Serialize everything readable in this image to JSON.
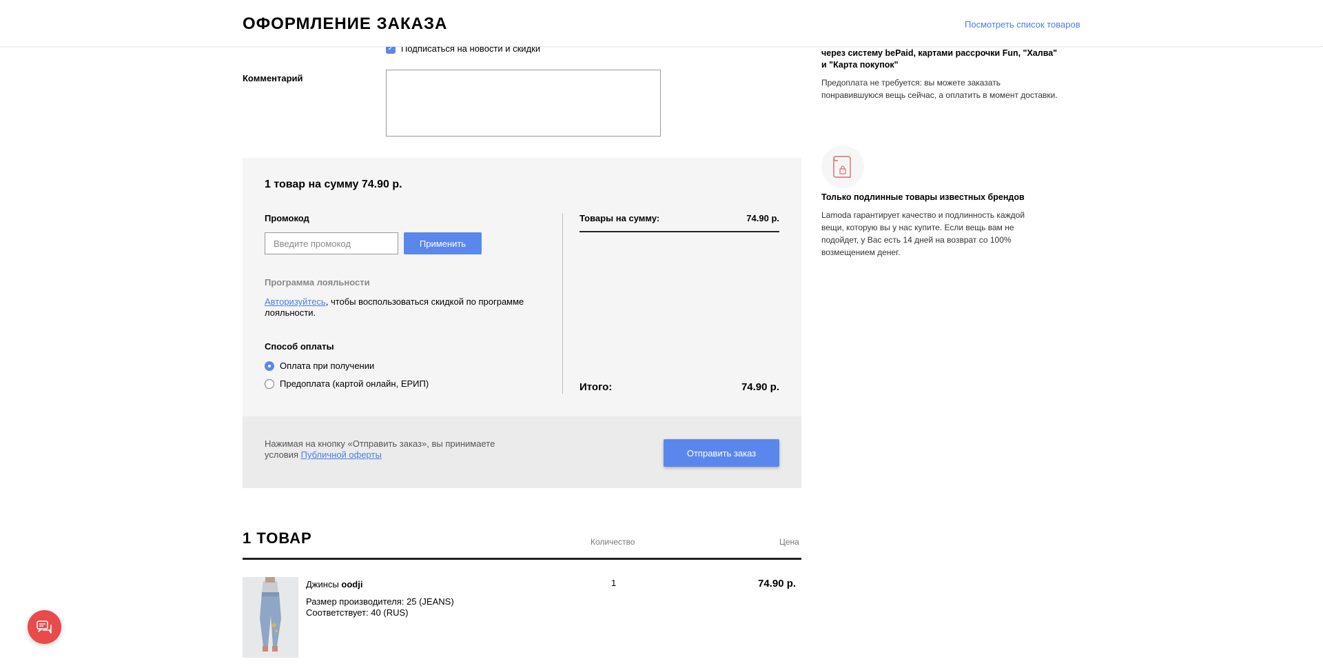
{
  "header": {
    "title": "ОФОРМЛЕНИЕ ЗАКАЗА",
    "view_list_link": "Посмотреть список товаров"
  },
  "form": {
    "subscribe_label": "Подписаться на новости и скидки",
    "subscribe_checked": true,
    "comment_label": "Комментарий",
    "comment_value": ""
  },
  "summary": {
    "title": "1 товар на сумму 74.90 р.",
    "promo_label": "Промокод",
    "promo_placeholder": "Введите промокод",
    "apply_label": "Применить",
    "loyalty_label": "Программа лояльности",
    "loyalty_link": "Авторизуйтесь",
    "loyalty_text": ", чтобы воспользоваться скидкой по программе лояльности.",
    "payment_label": "Способ оплаты",
    "payment_options": [
      {
        "label": "Оплата при получении",
        "selected": true
      },
      {
        "label": "Предоплата (картой онлайн, ЕРИП)",
        "selected": false
      }
    ],
    "goods_sum_label": "Товары на сумму:",
    "goods_sum_value": "74.90 р.",
    "total_label": "Итого:",
    "total_value": "74.90 р."
  },
  "submit": {
    "terms_text": "Нажимая на кнопку «Отправить заказ», вы принимаете условия ",
    "terms_link": "Публичной оферты",
    "button_label": "Отправить заказ"
  },
  "items": {
    "heading": "1 ТОВАР",
    "col_quantity": "Количество",
    "col_price": "Цена",
    "list": [
      {
        "name_prefix": "Джинсы",
        "brand": "oodji",
        "size_line": "Размер производителя: 25 (JEANS)",
        "match_line": "Соответствует: 40 (RUS)",
        "quantity": "1",
        "price": "74.90 р."
      }
    ]
  },
  "info": {
    "payment_title": "через систему \"Расчет\", онлайн банковской картой через систему bePaid, картами рассрочки Fun, \"Халва\" и \"Карта покупок\"",
    "payment_text": "Предоплата не требуется: вы можете заказать понравившуюся вещь сейчас, а оплатить в момент доставки.",
    "brands_title": "Только подлинные товары известных брендов",
    "brands_text": "Lamoda гарантирует качество и подлинность каждой вещи, которую вы у нас купите. Если вещь вам не подойдет, у Вас есть 14 дней на возврат со 100% возмещением денег."
  },
  "colors": {
    "accent": "#5b87ec",
    "link": "#4a7ce8",
    "chat": "#e94a4a"
  },
  "icons": [
    "check-icon",
    "certificate-icon",
    "chat-icon"
  ]
}
